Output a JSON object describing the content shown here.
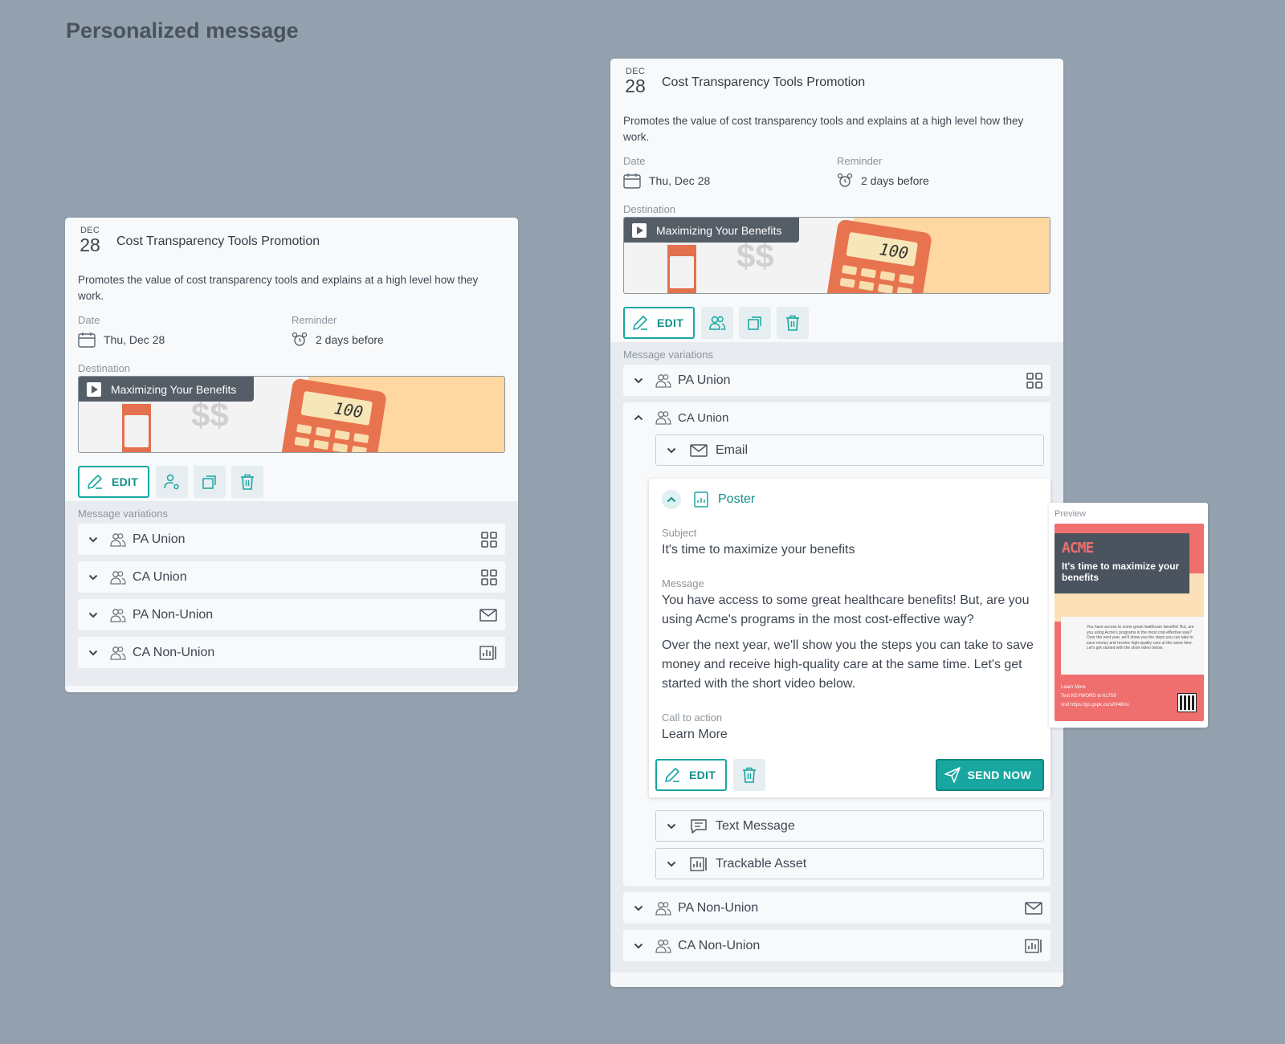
{
  "page": {
    "title": "Personalized message"
  },
  "card": {
    "month": "DEC",
    "day": "28",
    "title": "Cost Transparency Tools Promotion",
    "description": "Promotes the value of cost transparency tools and explains at a high level how they work.",
    "date_label": "Date",
    "date_value": "Thu, Dec 28",
    "reminder_label": "Reminder",
    "reminder_value": "2 days before",
    "destination_label": "Destination",
    "destination_name": "Maximizing Your Benefits",
    "banner_text": "$$",
    "calc_display": "100",
    "edit_label": "EDIT",
    "variations_label": "Message variations"
  },
  "variations": [
    {
      "label": "PA Union",
      "icon": "grid-icon"
    },
    {
      "label": "CA Union",
      "icon": "grid-icon"
    },
    {
      "label": "PA Non-Union",
      "icon": "envelope-icon"
    },
    {
      "label": "CA Non-Union",
      "icon": "chart-icon"
    }
  ],
  "channels": {
    "email": "Email",
    "poster": "Poster",
    "text_message": "Text Message",
    "trackable_asset": "Trackable Asset"
  },
  "poster": {
    "subject_label": "Subject",
    "subject": "It's time to maximize your benefits",
    "message_label": "Message",
    "message_p1": "You have access to some great healthcare benefits! But, are you using Acme's programs in the most cost-effective way?",
    "message_p2": "Over the next year, we'll show you the steps you can take to save money and receive high-quality care at the same time. Let's get started with the short video below.",
    "cta_label": "Call to action",
    "cta": "Learn More",
    "edit_label": "EDIT",
    "send_label": "SEND NOW"
  },
  "preview": {
    "label": "Preview",
    "brand": "ACME",
    "headline": "It's time to maximize your benefits",
    "body": "You have access to some great healthcare benefits! But, are you using Acme's programs in the most cost-effective way? Over the next year, we'll show you the steps you can take to save money and receive high-quality care at the same time. Let's get started with the short video below.",
    "learn_more": "Learn More",
    "text_line": "Text KEYWORD to 61759",
    "visit_line": "visit https://go.gspk.co/s/0r48rru"
  },
  "colors": {
    "accent": "#17a7a0",
    "background": "#93a1ae",
    "poster_red": "#ef6e6e",
    "banner_peach": "#ffd7a0"
  }
}
